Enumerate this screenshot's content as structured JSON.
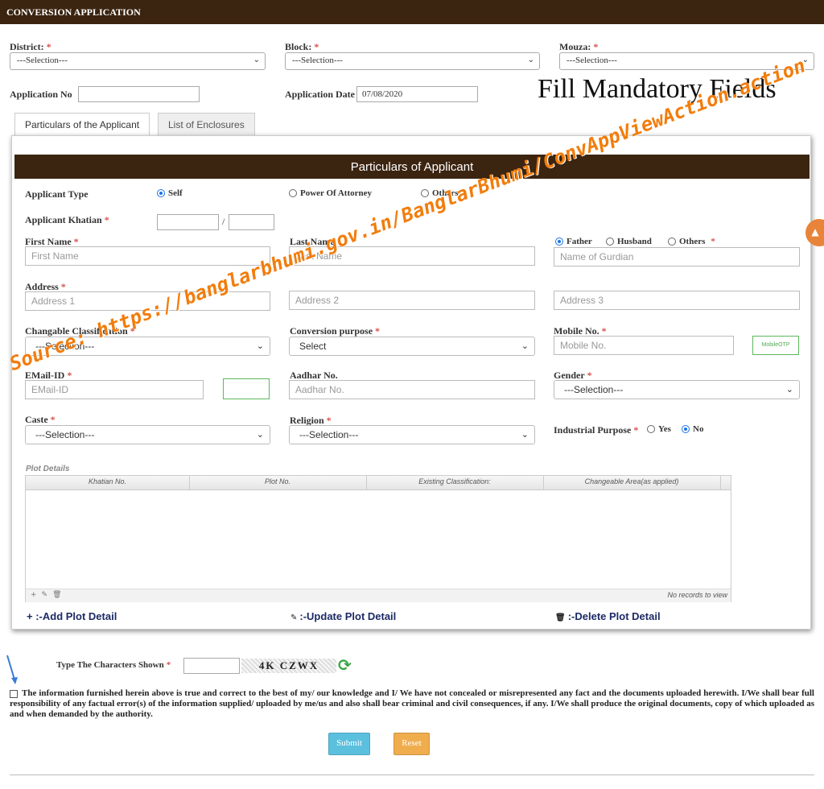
{
  "header": {
    "title": "CONVERSION APPLICATION"
  },
  "top_form": {
    "district": {
      "label": "District:",
      "value": "---Selection---"
    },
    "block": {
      "label": "Block:",
      "value": "---Selection---"
    },
    "mouza": {
      "label": "Mouza:",
      "value": "---Selection---"
    },
    "application_no": {
      "label": "Application No",
      "value": ""
    },
    "application_date": {
      "label": "Application Date",
      "value": "07/08/2020"
    },
    "required_mark": "*"
  },
  "annotation": {
    "text": "Fill Mandatory Fields"
  },
  "tabs": [
    {
      "label": "Particulars of the Applicant",
      "active": true
    },
    {
      "label": "List of Enclosures",
      "active": false
    }
  ],
  "panel": {
    "title": "Particulars of Applicant",
    "applicant_type": {
      "label": "Applicant Type",
      "options": [
        "Self",
        "Power Of Attorney",
        "Others"
      ],
      "selected": "Self"
    },
    "applicant_khatian": {
      "label": "Applicant Khatian",
      "separator": "/"
    },
    "first_name": {
      "label": "First Name",
      "placeholder": "First Name"
    },
    "last_name": {
      "label": "Last Name",
      "placeholder": "Last Name"
    },
    "guardian": {
      "options": [
        "Father",
        "Husband",
        "Others"
      ],
      "selected": "Father",
      "placeholder": "Name of Gurdian"
    },
    "address": {
      "label": "Address",
      "placeholders": [
        "Address 1",
        "Address 2",
        "Address 3"
      ]
    },
    "changable_classification": {
      "label": "Changable Classification",
      "value": "---Selection---"
    },
    "conversion_purpose": {
      "label": "Conversion purpose",
      "value": "Select"
    },
    "mobile": {
      "label": "Mobile No.",
      "placeholder": "Mobile No.",
      "otp_label": "MobileOTP"
    },
    "email": {
      "label": "EMail-ID",
      "placeholder": "EMail-ID"
    },
    "aadhar": {
      "label": "Aadhar No.",
      "placeholder": "Aadhar No."
    },
    "gender": {
      "label": "Gender",
      "value": "---Selection---"
    },
    "caste": {
      "label": "Caste",
      "value": "---Selection---"
    },
    "religion": {
      "label": "Religion",
      "value": "---Selection---"
    },
    "industrial_purpose": {
      "label": "Industrial Purpose",
      "options": [
        "Yes",
        "No"
      ],
      "selected": "No"
    },
    "plot_details": {
      "label": "Plot Details",
      "columns": [
        "Khatian No.",
        "Plot No.",
        "Existing Classification:",
        "Changeable Area(as applied)"
      ],
      "empty_text": "No records to view",
      "footer_icons": [
        "plus-icon",
        "pencil-icon",
        "trash-icon"
      ]
    },
    "actions": {
      "add": "+ :-Add Plot Detail",
      "update": ":-Update Plot Detail",
      "delete": ":-Delete Plot Detail"
    }
  },
  "captcha": {
    "label": "Type The Characters Shown",
    "text": "4K CZWX"
  },
  "declaration": "The information furnished herein above is true and correct to the best of my/ our knowledge and I/ We have not concealed or misrepresented any fact and the documents uploaded herewith. I/We shall bear full responsibility of any factual error(s) of the information supplied/ uploaded by me/us and also shall bear criminal and civil consequences, if any. I/We shall produce the original documents, copy of which uploaded as and when demanded by the authority.",
  "buttons": {
    "submit": "Submit",
    "reset": "Reset"
  },
  "watermark": "Source: https://banglarbhumi.gov.in/BanglarBhumi/ConvAppViewAction.action",
  "colors": {
    "brand_brown": "#3b2410",
    "accent_orange": "#f27d0c",
    "submit_blue": "#5bc0de",
    "reset_orange": "#f0ad4e"
  }
}
